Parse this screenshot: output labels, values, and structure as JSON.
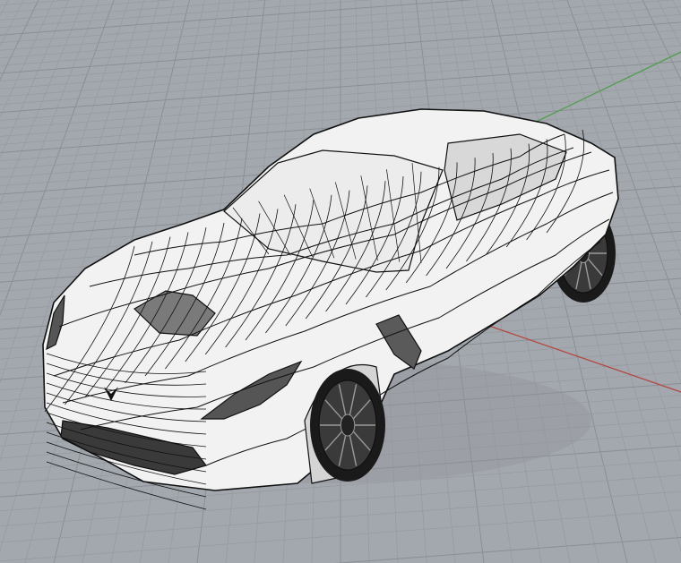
{
  "viewport": {
    "view": "perspective",
    "display_mode": "shaded-wireframe",
    "model": "car-mesh"
  },
  "colors": {
    "background": "#a3a8ae",
    "grid_minor": "#96999e",
    "grid_major": "#8b8f94",
    "x_axis": "#b24a44",
    "y_axis": "#4f9e4d",
    "mesh_surface": "#f2f2f2",
    "mesh_shadow": "#c9c9c9",
    "mesh_line": "#111111",
    "glass": "#e6e6e6"
  },
  "icons": [
    "construction-grid-icon",
    "x-axis-icon",
    "y-axis-icon",
    "car-mesh-icon"
  ]
}
